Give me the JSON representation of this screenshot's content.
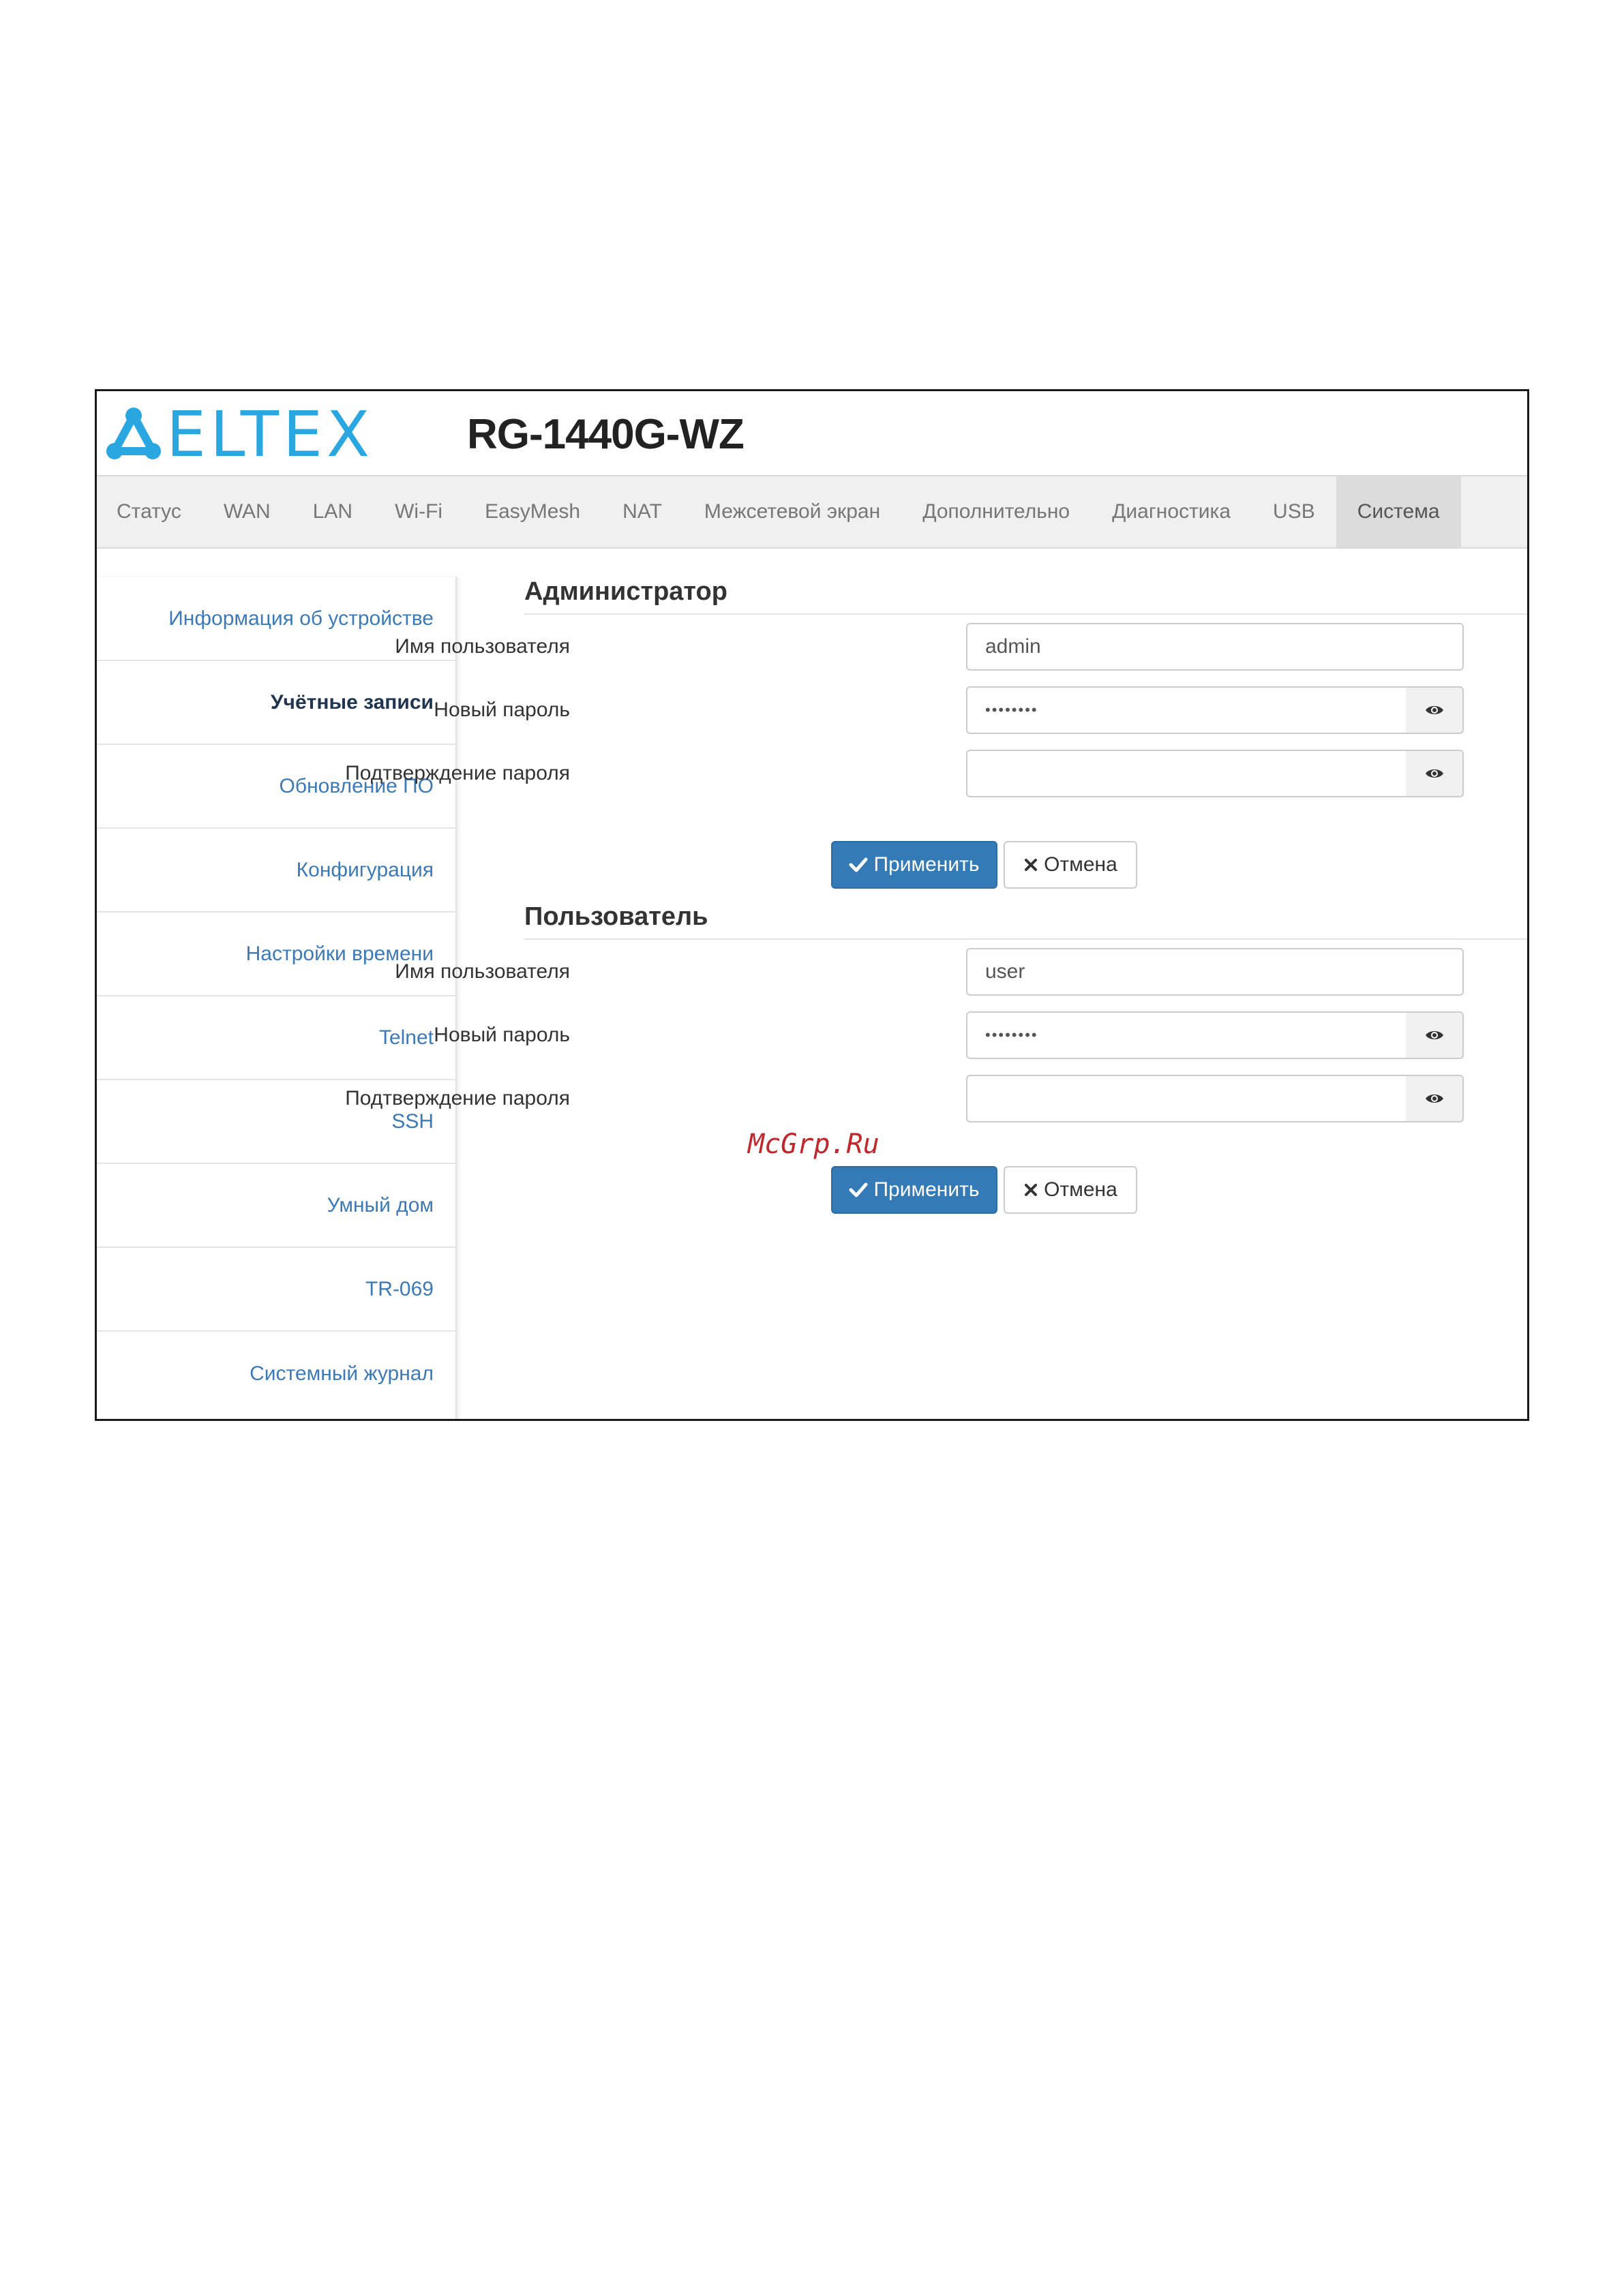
{
  "header": {
    "logo_text": "ELTEX",
    "model": "RG-1440G-WZ",
    "brand_color": "#2aa6e0"
  },
  "nav": {
    "tabs": [
      {
        "label": "Статус"
      },
      {
        "label": "WAN"
      },
      {
        "label": "LAN"
      },
      {
        "label": "Wi-Fi"
      },
      {
        "label": "EasyMesh"
      },
      {
        "label": "NAT"
      },
      {
        "label": "Межсетевой экран"
      },
      {
        "label": "Дополнительно"
      },
      {
        "label": "Диагностика"
      },
      {
        "label": "USB"
      },
      {
        "label": "Система"
      }
    ],
    "active": "Система"
  },
  "sidebar": {
    "items": [
      {
        "label": "Информация об устройстве"
      },
      {
        "label": "Учётные записи"
      },
      {
        "label": "Обновление ПО"
      },
      {
        "label": "Конфигурация"
      },
      {
        "label": "Настройки времени"
      },
      {
        "label": "Telnet"
      },
      {
        "label": "SSH"
      },
      {
        "label": "Умный дом"
      },
      {
        "label": "TR-069"
      },
      {
        "label": "Системный журнал"
      }
    ],
    "active": "Учётные записи"
  },
  "admin": {
    "title": "Администратор",
    "username_label": "Имя пользователя",
    "username_value": "admin",
    "password_label": "Новый пароль",
    "password_value": "••••••••",
    "confirm_label": "Подтверждение пароля",
    "confirm_value": "",
    "apply_label": "Применить",
    "cancel_label": "Отмена"
  },
  "user": {
    "title": "Пользователь",
    "username_label": "Имя пользователя",
    "username_value": "user",
    "password_label": "Новый пароль",
    "password_value": "••••••••",
    "confirm_label": "Подтверждение пароля",
    "confirm_value": "",
    "apply_label": "Применить",
    "cancel_label": "Отмена"
  },
  "watermark": "McGrp.Ru",
  "colors": {
    "primary_button": "#337ab7",
    "sidebar_link": "#3c7ab7",
    "watermark": "#c0282d"
  }
}
